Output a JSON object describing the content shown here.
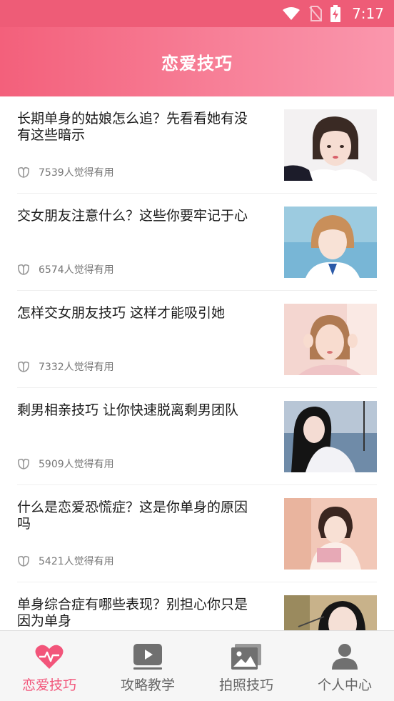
{
  "status_bar": {
    "time": "7:17"
  },
  "header": {
    "title": "恋爱技巧"
  },
  "articles": [
    {
      "title": "长期单身的姑娘怎么追？先看看她有没有这些暗示",
      "count": "7539人觉得有用"
    },
    {
      "title": "交女朋友注意什么？这些你要牢记于心",
      "count": "6574人觉得有用"
    },
    {
      "title": "怎样交女朋友技巧 这样才能吸引她",
      "count": "7332人觉得有用"
    },
    {
      "title": "剩男相亲技巧 让你快速脱离剩男团队",
      "count": "5909人觉得有用"
    },
    {
      "title": "什么是恋爱恐慌症？这是你单身的原因吗",
      "count": "5421人觉得有用"
    },
    {
      "title": "单身综合症有哪些表现？别担心你只是因为单身",
      "count": ""
    }
  ],
  "tabs": [
    {
      "label": "恋爱技巧",
      "icon": "heart-pulse-icon",
      "active": true
    },
    {
      "label": "攻略教学",
      "icon": "video-play-icon",
      "active": false
    },
    {
      "label": "拍照技巧",
      "icon": "photo-gallery-icon",
      "active": false
    },
    {
      "label": "个人中心",
      "icon": "user-icon",
      "active": false
    }
  ],
  "colors": {
    "accent": "#f2557a",
    "header_start": "#f3607b",
    "header_end": "#fa97ad",
    "tab_inactive": "#666666"
  }
}
